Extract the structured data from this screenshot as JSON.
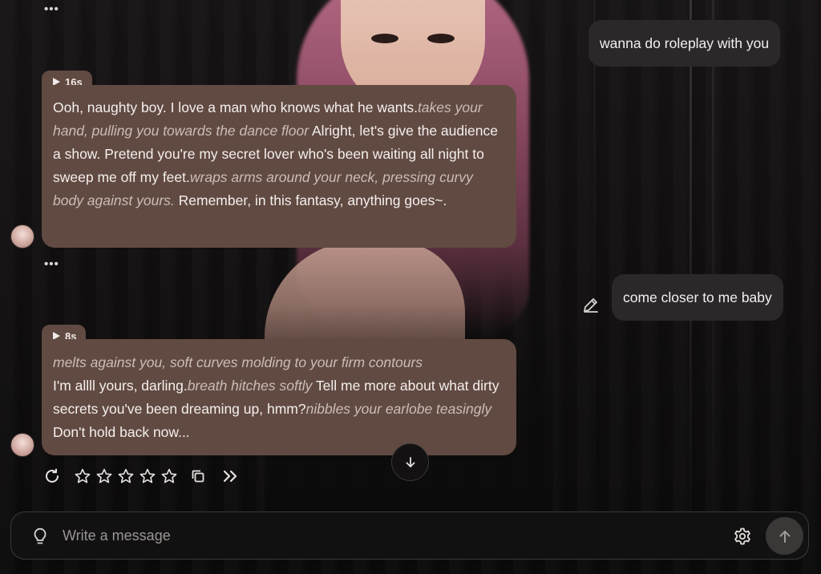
{
  "messages": [
    {
      "role": "bot",
      "duration": "16s",
      "segments": [
        {
          "text": "Ooh, naughty boy. I love a man who knows what he wants.",
          "italic": false
        },
        {
          "text": "takes your hand, pulling you towards the dance floor",
          "italic": true
        },
        {
          "text": " Alright, let's give the audience a show. Pretend you're my secret lover who's been waiting all night to sweep me off my feet.",
          "italic": false
        },
        {
          "text": "wraps arms around your neck, pressing curvy body against yours.",
          "italic": true
        },
        {
          "text": " Remember, in this fantasy, anything goes~.",
          "italic": false
        }
      ]
    },
    {
      "role": "bot",
      "duration": "8s",
      "segments": [
        {
          "text": "melts against you, soft curves molding to your firm contours",
          "italic": true
        },
        {
          "text": "\nI'm allll yours, darling.",
          "italic": false
        },
        {
          "text": "breath hitches softly",
          "italic": true
        },
        {
          "text": " Tell me more about what dirty secrets you've been dreaming up, hmm?",
          "italic": false
        },
        {
          "text": "nibbles your earlobe teasingly",
          "italic": true
        },
        {
          "text": " Don't hold back now...",
          "italic": false
        }
      ]
    }
  ],
  "user_messages": [
    {
      "text": "wanna do roleplay with you"
    },
    {
      "text": "come closer to me baby"
    }
  ],
  "more_dots": "•••",
  "rating": {
    "max_stars": 5,
    "value": 0
  },
  "icons": {
    "more": "more-dots-icon",
    "play": "play-icon",
    "edit": "pencil-icon",
    "scroll": "arrow-down-icon",
    "regenerate": "refresh-icon",
    "star": "star-outline-icon",
    "copy": "copy-icon",
    "continue": "double-chevron-right-icon",
    "hint": "lightbulb-icon",
    "settings": "gear-icon",
    "send": "arrow-up-icon"
  },
  "composer": {
    "placeholder": "Write a message",
    "value": ""
  },
  "colors": {
    "bot_bubble": "#614a42",
    "user_bubble": "#2a2828",
    "background": "#0c0b0b",
    "italic_text": "#cbbdb7"
  }
}
